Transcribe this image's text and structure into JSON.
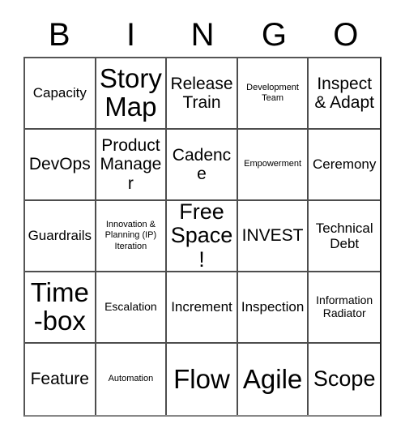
{
  "header": {
    "letters": [
      "B",
      "I",
      "N",
      "G",
      "O"
    ]
  },
  "grid": {
    "rows": 5,
    "columns": 5,
    "cells": [
      {
        "text": "Capacity",
        "size": "md"
      },
      {
        "text": "Story Map",
        "size": "xxl"
      },
      {
        "text": "Release Train",
        "size": "lg"
      },
      {
        "text": "Development Team",
        "size": "xs"
      },
      {
        "text": "Inspect & Adapt",
        "size": "lg"
      },
      {
        "text": "DevOps",
        "size": "lg"
      },
      {
        "text": "Product Manager",
        "size": "lg"
      },
      {
        "text": "Cadence",
        "size": "lg"
      },
      {
        "text": "Empowerment",
        "size": "xs"
      },
      {
        "text": "Ceremony",
        "size": "md"
      },
      {
        "text": "Guardrails",
        "size": "md"
      },
      {
        "text": "Innovation & Planning (IP) Iteration",
        "size": "xs"
      },
      {
        "text": "Free Space!",
        "size": "xl"
      },
      {
        "text": "INVEST",
        "size": "lg"
      },
      {
        "text": "Technical Debt",
        "size": "md"
      },
      {
        "text": "Time-box",
        "size": "xxl"
      },
      {
        "text": "Escalation",
        "size": "sm"
      },
      {
        "text": "Increment",
        "size": "md"
      },
      {
        "text": "Inspection",
        "size": "md"
      },
      {
        "text": "Information Radiator",
        "size": "sm"
      },
      {
        "text": "Feature",
        "size": "lg"
      },
      {
        "text": "Automation",
        "size": "xs"
      },
      {
        "text": "Flow",
        "size": "xxl"
      },
      {
        "text": "Agile",
        "size": "xxl"
      },
      {
        "text": "Scope",
        "size": "xl"
      }
    ]
  },
  "colors": {
    "background": "#ffffff",
    "text": "#000000",
    "grid_line": "#4d4d4d"
  }
}
